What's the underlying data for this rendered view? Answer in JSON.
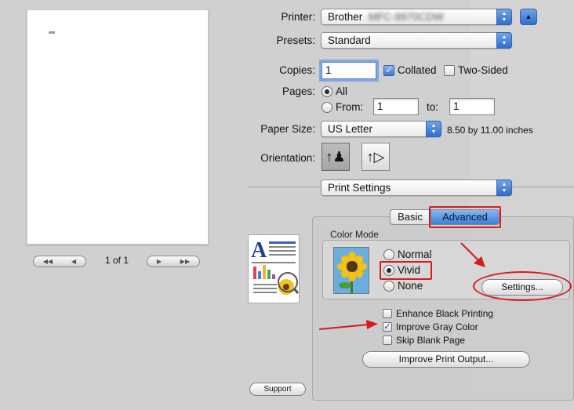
{
  "printer": {
    "label": "Printer:",
    "value": "Brother"
  },
  "presets": {
    "label": "Presets:",
    "value": "Standard"
  },
  "copies": {
    "label": "Copies:",
    "value": "1",
    "collated_label": "Collated",
    "collated": true,
    "two_sided_label": "Two-Sided",
    "two_sided": false
  },
  "pages": {
    "label": "Pages:",
    "all_label": "All",
    "from_label": "From:",
    "from_value": "1",
    "to_label": "to:",
    "to_value": "1",
    "selected": "All"
  },
  "paper": {
    "label": "Paper Size:",
    "value": "US Letter",
    "dimensions": "8.50 by 11.00 inches"
  },
  "orientation": {
    "label": "Orientation:",
    "selected": "portrait"
  },
  "preview": {
    "page_count": "1 of 1"
  },
  "section_popup": {
    "value": "Print Settings"
  },
  "tabs": {
    "basic": "Basic",
    "advanced": "Advanced",
    "selected": "Advanced"
  },
  "color_mode": {
    "title": "Color Mode",
    "options": [
      "Normal",
      "Vivid",
      "None"
    ],
    "selected": "Vivid",
    "settings_button": "Settings..."
  },
  "checks": [
    {
      "label": "Enhance Black Printing",
      "checked": false
    },
    {
      "label": "Improve Gray Color",
      "checked": true
    },
    {
      "label": "Skip Blank Page",
      "checked": false
    }
  ],
  "improve_button": "Improve Print Output...",
  "support_button": "Support",
  "annotations": {
    "color": "#d41d1d"
  }
}
